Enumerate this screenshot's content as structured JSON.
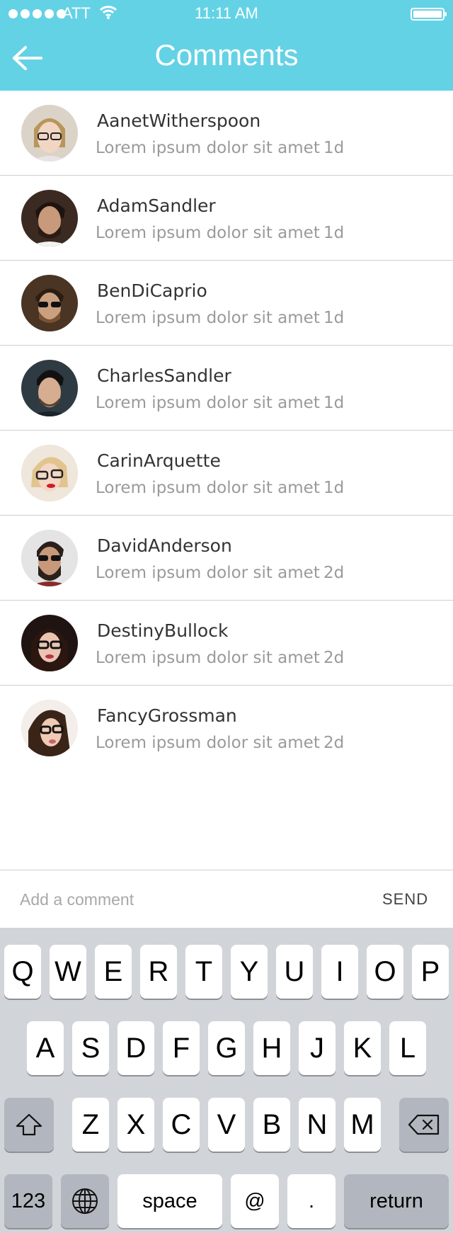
{
  "status_bar": {
    "carrier": "ATT",
    "time": "11:11 AM"
  },
  "header": {
    "title": "Comments",
    "back_icon": "arrow-left-icon",
    "background_color": "#64d2e5"
  },
  "comments": [
    {
      "name": "AanetWitherspoon",
      "message": "Lorem ipsum dolor sit amet",
      "age": "1d"
    },
    {
      "name": "AdamSandler",
      "message": "Lorem ipsum dolor sit amet",
      "age": "1d"
    },
    {
      "name": "BenDiCaprio",
      "message": "Lorem ipsum dolor sit amet",
      "age": "1d"
    },
    {
      "name": "CharlesSandler",
      "message": "Lorem ipsum dolor sit amet",
      "age": "1d"
    },
    {
      "name": "CarinArquette",
      "message": "Lorem ipsum dolor sit amet",
      "age": "1d"
    },
    {
      "name": "DavidAnderson",
      "message": "Lorem ipsum dolor sit amet",
      "age": "2d"
    },
    {
      "name": "DestinyBullock",
      "message": "Lorem ipsum dolor sit amet",
      "age": "2d"
    },
    {
      "name": "FancyGrossman",
      "message": "Lorem ipsum dolor sit amet",
      "age": "2d"
    }
  ],
  "comment_bar": {
    "placeholder": "Add a comment",
    "value": "",
    "send_label": "SEND"
  },
  "keyboard": {
    "row1": [
      "Q",
      "W",
      "E",
      "R",
      "T",
      "Y",
      "U",
      "I",
      "O",
      "P"
    ],
    "row2": [
      "A",
      "S",
      "D",
      "F",
      "G",
      "H",
      "J",
      "K",
      "L"
    ],
    "row3": [
      "Z",
      "X",
      "C",
      "V",
      "B",
      "N",
      "M"
    ],
    "numbers_label": "123",
    "space_label": "space",
    "at_label": "@",
    "period_label": ".",
    "return_label": "return"
  }
}
